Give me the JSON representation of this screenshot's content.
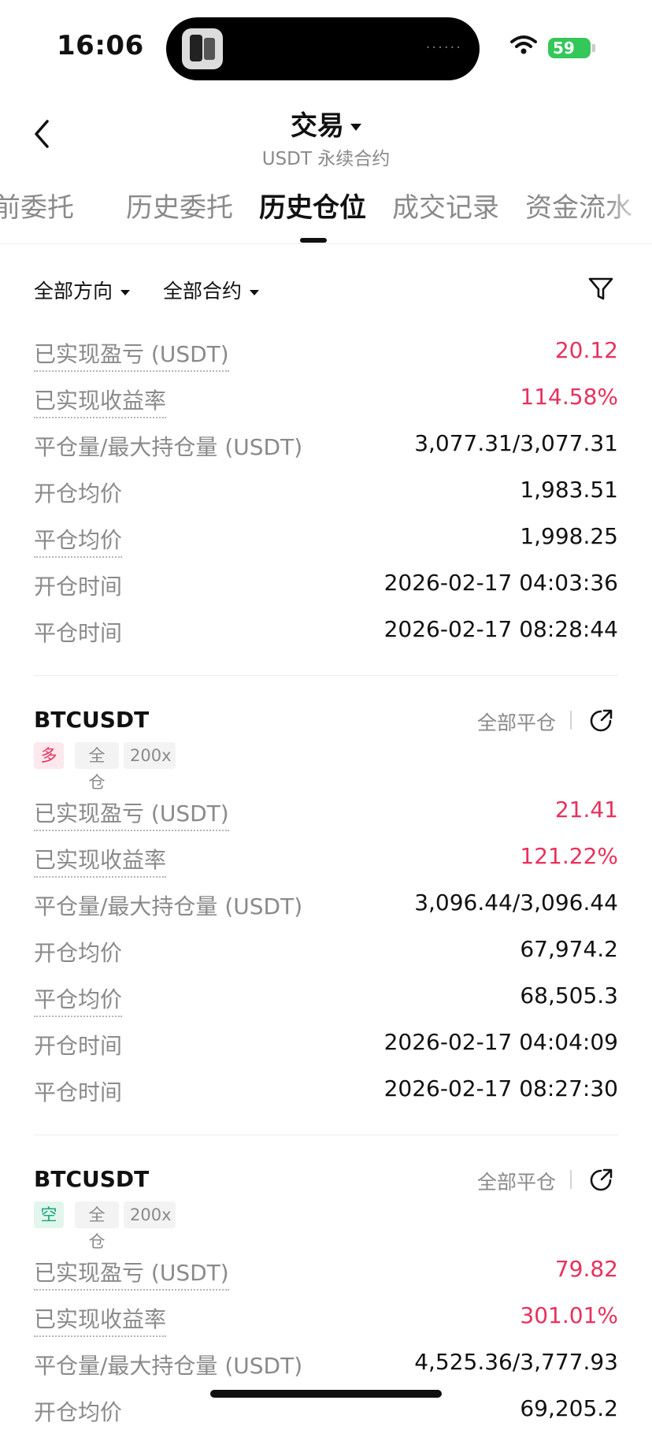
{
  "status_bar": {
    "time": "16:06",
    "battery": "59"
  },
  "header": {
    "title": "交易",
    "subtitle": "USDT 永续合约"
  },
  "tabs": [
    "前委托",
    "历史委托",
    "历史仓位",
    "成交记录",
    "资金流水"
  ],
  "active_tab": "历史仓位",
  "filters": {
    "direction": "全部方向",
    "contract": "全部合约"
  },
  "labels": {
    "realized_pnl": "已实现盈亏 (USDT)",
    "realized_roe": "已实现收益率",
    "close_max_qty": "平仓量/最大持仓量 (USDT)",
    "open_avg": "开仓均价",
    "close_avg": "平仓均价",
    "open_time": "开仓时间",
    "close_time": "平仓时间"
  },
  "close_all_label": "全部平仓",
  "positions": [
    {
      "realized_pnl": "20.12",
      "realized_roe": "114.58%",
      "close_max_qty": "3,077.31/3,077.31",
      "open_avg": "1,983.51",
      "close_avg": "1,998.25",
      "open_time": "2026-02-17 04:03:36",
      "close_time": "2026-02-17 08:28:44"
    },
    {
      "symbol": "BTCUSDT",
      "side": "多",
      "margin": "全仓",
      "leverage": "200x",
      "realized_pnl": "21.41",
      "realized_roe": "121.22%",
      "close_max_qty": "3,096.44/3,096.44",
      "open_avg": "67,974.2",
      "close_avg": "68,505.3",
      "open_time": "2026-02-17 04:04:09",
      "close_time": "2026-02-17 08:27:30"
    },
    {
      "symbol": "BTCUSDT",
      "side": "空",
      "margin": "全仓",
      "leverage": "200x",
      "realized_pnl": "79.82",
      "realized_roe": "301.01%",
      "close_max_qty": "4,525.36/3,777.93",
      "open_avg": "69,205.2"
    }
  ],
  "colors": {
    "profit": "#e8315c",
    "long": "#e8315c",
    "short": "#17a877",
    "muted": "#8a8a8a"
  }
}
